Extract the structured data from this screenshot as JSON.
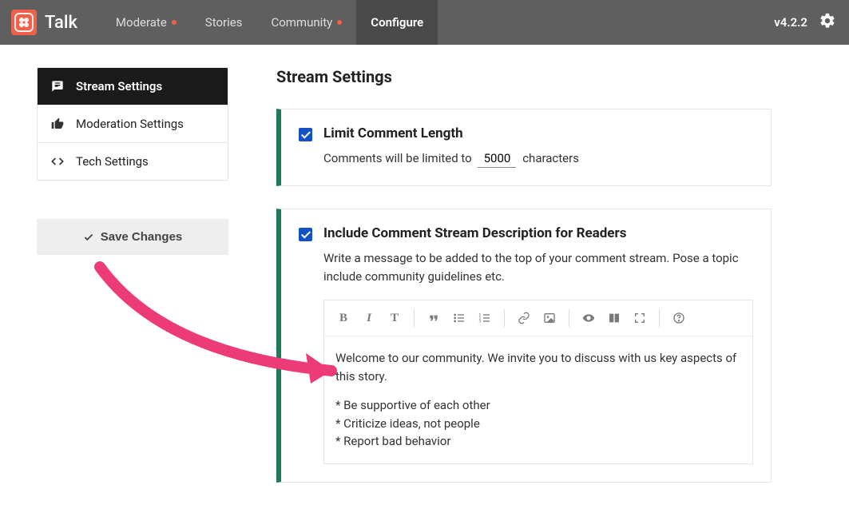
{
  "brand": {
    "name": "Talk"
  },
  "nav": {
    "items": [
      {
        "label": "Moderate",
        "dot": true
      },
      {
        "label": "Stories",
        "dot": false
      },
      {
        "label": "Community",
        "dot": true
      },
      {
        "label": "Configure",
        "dot": false,
        "active": true
      }
    ],
    "version": "v4.2.2"
  },
  "sidebar": {
    "items": [
      {
        "label": "Stream Settings",
        "active": true
      },
      {
        "label": "Moderation Settings"
      },
      {
        "label": "Tech Settings"
      }
    ],
    "save_label": "Save Changes"
  },
  "main": {
    "title": "Stream Settings",
    "limit": {
      "title": "Limit Comment Length",
      "desc_pre": "Comments will be limited to",
      "value": "5000",
      "desc_post": "characters"
    },
    "desc": {
      "title": "Include Comment Stream Description for Readers",
      "help": "Write a message to be added to the top of your comment stream. Pose a topic include community guidelines etc.",
      "body_p1": "Welcome to our community. We invite you to discuss with us key aspects of this story.",
      "body_l1": "* Be supportive of each other",
      "body_l2": "* Criticize ideas, not people",
      "body_l3": "* Report bad behavior"
    }
  }
}
